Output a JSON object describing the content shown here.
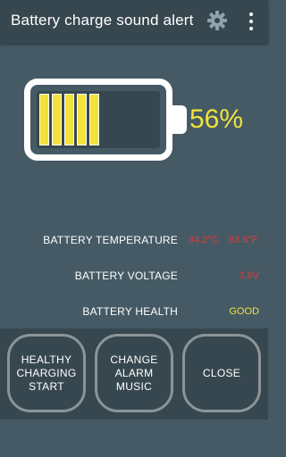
{
  "app": {
    "title": "Battery charge sound alert"
  },
  "toolbar": {
    "settings_icon": "gear-icon",
    "overflow_icon": "more-vert-icon"
  },
  "battery": {
    "level_text": "56%",
    "level_fraction": 0.56,
    "filled_segments": 5,
    "fill_color": "#f2e23a"
  },
  "stats": {
    "temperature_label": "BATTERY TEMPERATURE",
    "temperature_c": "34.2°C",
    "temperature_f": "93.6°F",
    "voltage_label": "BATTERY VOLTAGE",
    "voltage_value": "3.8V",
    "health_label": "BATTERY HEALTH",
    "health_value": "GOOD"
  },
  "buttons": {
    "healthy_charging": "HEALTHY\nCHARGING\nSTART",
    "change_alarm": "CHANGE\nALARM\nMUSIC",
    "close": "CLOSE"
  },
  "colors": {
    "background": "#455a64",
    "panel": "#37474f",
    "accent_yellow": "#f2e23a",
    "warning_red": "#e53935"
  }
}
